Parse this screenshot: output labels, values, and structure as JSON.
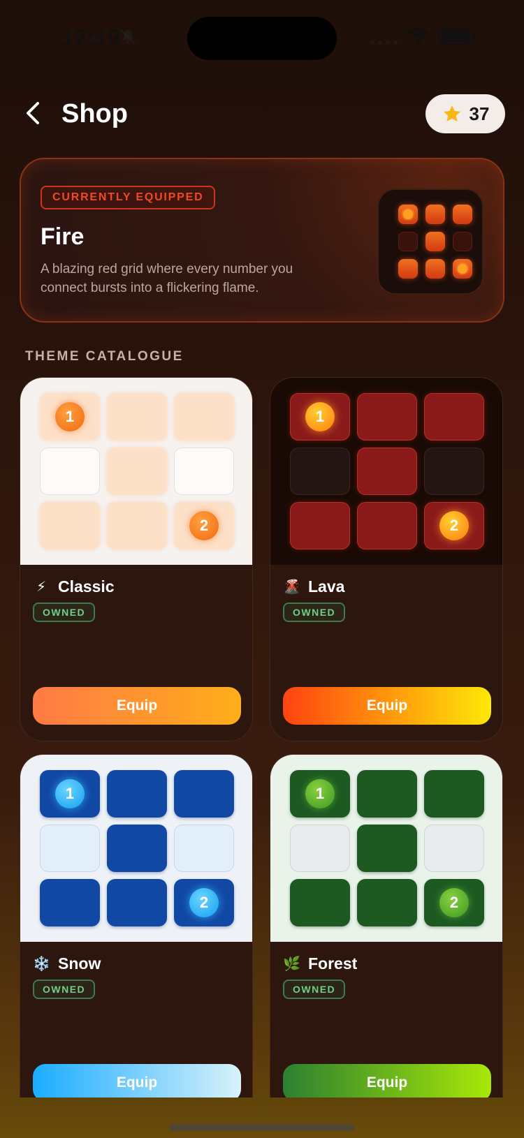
{
  "status_bar": {
    "time": "12:19"
  },
  "header": {
    "title": "Shop",
    "stars_count": "37"
  },
  "equipped": {
    "badge": "CURRENTLY EQUIPPED",
    "name": "Fire",
    "description": "A blazing red grid where every number you connect bursts into a flickering flame."
  },
  "catalogue": {
    "label": "THEME CATALOGUE",
    "themes": [
      {
        "name": "Classic",
        "icon": "⚡",
        "status": "OWNED",
        "action": "Equip"
      },
      {
        "name": "Lava",
        "icon": "🌋",
        "status": "OWNED",
        "action": "Equip"
      },
      {
        "name": "Snow",
        "icon": "❄️",
        "status": "OWNED",
        "action": "Equip"
      },
      {
        "name": "Forest",
        "icon": "🌿",
        "status": "OWNED",
        "action": "Equip"
      }
    ]
  },
  "preview_numbers": {
    "start": "1",
    "end": "2"
  },
  "colors": {
    "accent": "#ef4a24",
    "owned": "#6fd088",
    "star": "#f5b814"
  },
  "icons": [
    "bell-slash-icon",
    "wifi-icon",
    "battery-icon",
    "back-chevron-icon",
    "star-icon"
  ]
}
